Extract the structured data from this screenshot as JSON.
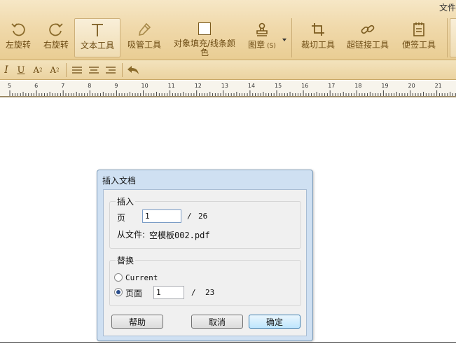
{
  "window": {
    "title": "文件"
  },
  "toolbar": {
    "rotate_left": "左旋转",
    "rotate_right": "右旋转",
    "text_tool": "文本工具",
    "eyedropper_tool": "吸管工具",
    "fill_stroke_line1": "对象填充/线条颜",
    "fill_stroke_line2": "色",
    "stamp": "图章",
    "stamp_shortcut": "(S)",
    "crop_tool": "裁切工具",
    "hyperlink_tool": "超链接工具",
    "note_tool": "便签工具"
  },
  "format_bar": {
    "italic": "I",
    "underline": "U",
    "superscript_base": "A",
    "superscript_mark": "2",
    "subscript_base": "A",
    "subscript_mark": "2"
  },
  "ruler": {
    "ticks": [
      "5",
      "6",
      "7",
      "8",
      "9",
      "10",
      "11",
      "12",
      "13",
      "14",
      "15",
      "16",
      "17",
      "18",
      "19",
      "20",
      "21"
    ]
  },
  "dialog": {
    "title": "插入文档",
    "insert_group": {
      "label": "插入",
      "page_label": "页",
      "page_value": "1",
      "separator": "/",
      "total_pages": "26",
      "from_file_label": "从文件:",
      "from_file_name": "空模板002.pdf"
    },
    "replace_group": {
      "label": "替换",
      "option_current": "Current",
      "option_page": "页面",
      "page_value": "1",
      "separator": "/",
      "total_pages": "23",
      "selected_option": "页面"
    },
    "buttons": {
      "help": "帮助",
      "cancel": "取消",
      "ok": "确定"
    }
  },
  "colors": {
    "ribbon": "#f0d9ab",
    "icon": "#7a5a1e",
    "dialog_frame": "#cfe0f2"
  }
}
